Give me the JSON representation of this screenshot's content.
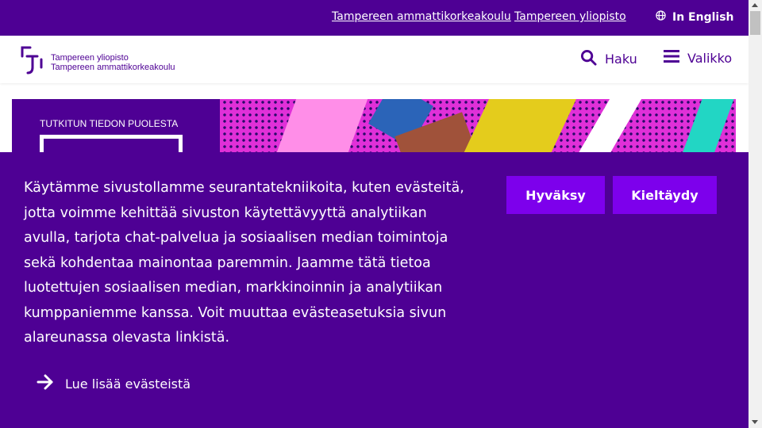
{
  "topbar": {
    "link_tamk": "Tampereen ammattikorkeakoulu",
    "link_uni": "Tampereen yliopisto",
    "lang_label": "In English"
  },
  "header": {
    "logo_line1": "Tampereen yliopisto",
    "logo_line2": "Tampereen ammattikorkeakoulu",
    "search_label": "Haku",
    "menu_label": "Valikko"
  },
  "hero": {
    "kicker": "TUTKITUN TIEDON PUOLESTA"
  },
  "cookie": {
    "text": "Käytämme sivustollamme seurantatekniikoita, kuten evästeitä, jotta voimme kehittää sivuston käytettävyyttä analytiikan avulla, tarjota chat-palvelua ja sosiaalisen median toimintoja sekä kohdentaa mainontaa paremmin. Jaamme tätä tietoa luotettujen sosiaalisen median, markkinoinnin ja analytiikan kumppaniemme kanssa. Voit muuttaa evästeasetuksia sivun alareunassa olevasta linkistä.",
    "accept_label": "Hyväksy",
    "decline_label": "Kieltäydy",
    "read_more_label": "Lue lisää evästeistä"
  },
  "colors": {
    "brand_purple": "#4e0094",
    "button_purple": "#7d00ec",
    "hero_magenta": "#e030d8"
  }
}
